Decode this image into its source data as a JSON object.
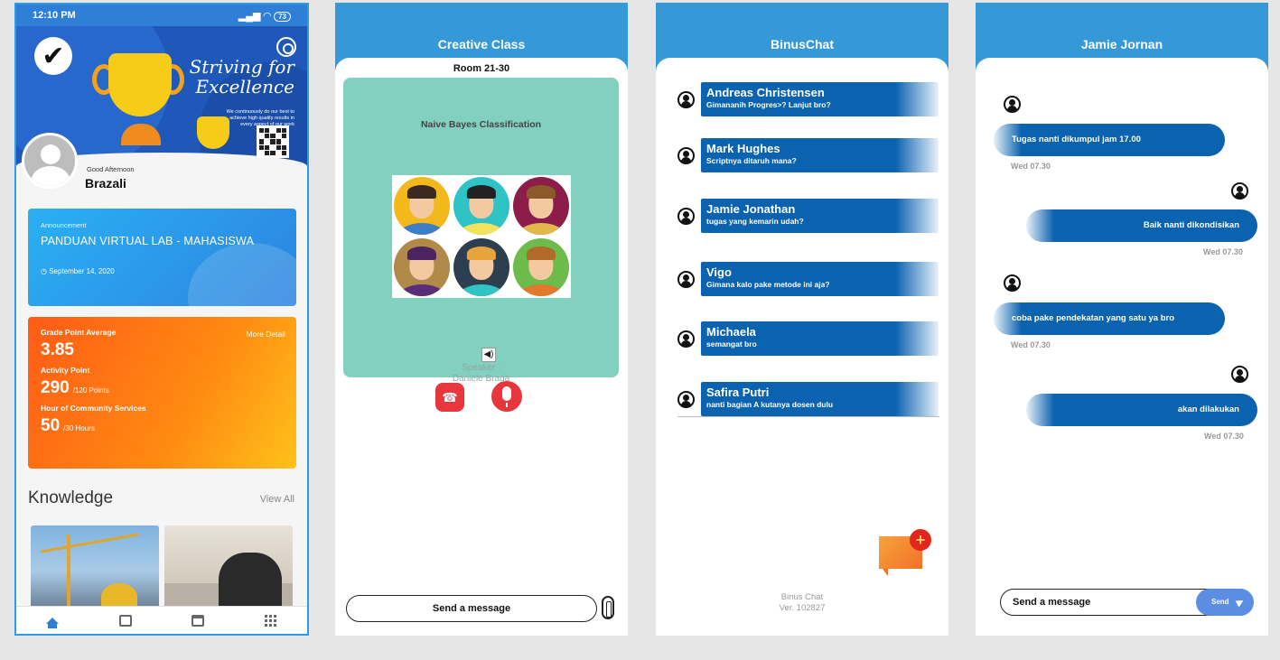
{
  "home": {
    "status_time": "12:10 PM",
    "battery": "73",
    "banner_title": "Striving for Excellence",
    "banner_sub": "We continuously do our best to achieve high quality results in every aspect of our work",
    "greeting": "Good Afternoon",
    "user_name": "Brazali",
    "announcement": {
      "label": "Announcement",
      "title": "PANDUAN VIRTUAL LAB - MAHASISWA",
      "date": "September 14, 2020"
    },
    "gpa": {
      "gpa_label": "Grade Point Average",
      "more_detail": "More Detail",
      "gpa_value": "3.85",
      "activity_label": "Activity Point",
      "activity_value": "290",
      "activity_unit": "/120 Points",
      "community_label": "Hour of Community Services",
      "community_value": "50",
      "community_unit": "/30 Hours"
    },
    "knowledge_title": "Knowledge",
    "view_all": "View All",
    "tabs": [
      "home-icon",
      "news-icon",
      "calendar-icon",
      "grid-icon"
    ]
  },
  "class": {
    "title": "Creative Class",
    "room": "Room 21-30",
    "topic": "Naive Bayes Classification",
    "speaker_label": "Speaker :",
    "speaker_name": "Daniele Braga",
    "send_label": "Send a message"
  },
  "chatlist": {
    "title": "BinusChat",
    "chats": [
      {
        "name": "Andreas Christensen",
        "message": "Gimananih Progres>? Lanjut bro?"
      },
      {
        "name": "Mark Hughes",
        "message": "Scriptnya ditaruh mana?"
      },
      {
        "name": "Jamie Jonathan",
        "message": "tugas yang kemarin udah?"
      },
      {
        "name": "Vigo",
        "message": "Gimana kalo pake metode ini aja?"
      },
      {
        "name": "Michaela",
        "message": "semangat bro"
      },
      {
        "name": "Safira Putri",
        "message": "nanti bagian A kutanya dosen dulu"
      }
    ],
    "app_name": "Binus Chat",
    "version": "Ver. 102827"
  },
  "dm": {
    "title": "Jamie Jornan",
    "messages": [
      {
        "side": "in",
        "text": "Tugas nanti dikumpul jam 17.00",
        "time": "Wed 07.30"
      },
      {
        "side": "out",
        "text": "Baik nanti dikondisikan",
        "time": "Wed 07.30"
      },
      {
        "side": "in",
        "text": "coba pake pendekatan yang satu ya bro",
        "time": "Wed 07.30"
      },
      {
        "side": "out",
        "text": "akan dilakukan",
        "time": "Wed 07.30"
      }
    ],
    "input_placeholder": "Send a message",
    "send_label": "Send"
  },
  "colors": {
    "primary_blue": "#3599d8",
    "bubble_blue": "#0b63b0",
    "orange": "#ff8a12",
    "red": "#e8363c"
  }
}
